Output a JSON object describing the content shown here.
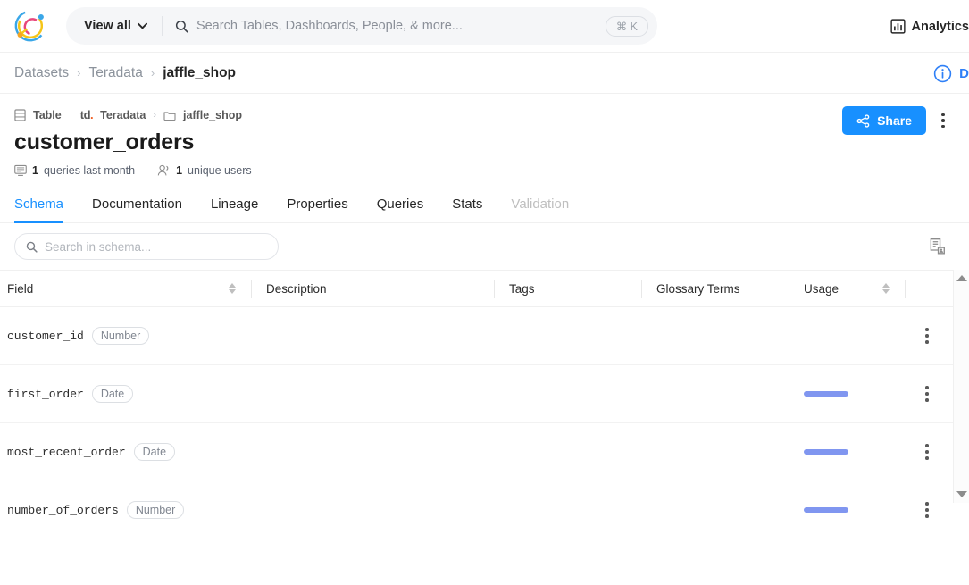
{
  "topbar": {
    "logo_name": "datahub-logo",
    "view_all_label": "View all",
    "search_placeholder": "Search Tables, Dashboards, People, & more...",
    "search_value": "",
    "shortcut_hint": "⌘ K",
    "nav_items": [
      {
        "label": "Analytics",
        "icon": "bar-chart-icon"
      }
    ]
  },
  "breadcrumb": {
    "items": [
      {
        "label": "Datasets",
        "current": false
      },
      {
        "label": "Teradata",
        "current": false
      },
      {
        "label": "jaffle_shop",
        "current": true
      }
    ],
    "separator": "›",
    "docs_label": "D"
  },
  "entity": {
    "type_label": "Table",
    "platform_logo": "td",
    "platform_logo_dot": ".",
    "platform_label": "Teradata",
    "container_label": "jaffle_shop",
    "container_separator": "›",
    "title": "customer_orders",
    "stats": [
      {
        "count": "1",
        "text": "queries last month",
        "icon": "query-monitor-icon"
      },
      {
        "count": "1",
        "text": "unique users",
        "icon": "users-icon"
      }
    ],
    "share_label": "Share",
    "share_color": "#1890ff",
    "menu_name": "more-options"
  },
  "tabs": [
    {
      "label": "Schema",
      "active": true,
      "disabled": false
    },
    {
      "label": "Documentation",
      "active": false,
      "disabled": false
    },
    {
      "label": "Lineage",
      "active": false,
      "disabled": false
    },
    {
      "label": "Properties",
      "active": false,
      "disabled": false
    },
    {
      "label": "Queries",
      "active": false,
      "disabled": false
    },
    {
      "label": "Stats",
      "active": false,
      "disabled": false
    },
    {
      "label": "Validation",
      "active": false,
      "disabled": true
    }
  ],
  "schema_toolbar": {
    "search_placeholder": "Search in schema...",
    "search_value": "",
    "raw_schema_icon": "raw-schema-icon"
  },
  "schema_table": {
    "columns": [
      {
        "label": "Field",
        "sortable": true
      },
      {
        "label": "Description",
        "sortable": false
      },
      {
        "label": "Tags",
        "sortable": false
      },
      {
        "label": "Glossary Terms",
        "sortable": false
      },
      {
        "label": "Usage",
        "sortable": true
      }
    ],
    "rows": [
      {
        "field": "customer_id",
        "type": "Number",
        "description": "",
        "tags": "",
        "glossary": "",
        "usage_width": 0
      },
      {
        "field": "first_order",
        "type": "Date",
        "description": "",
        "tags": "",
        "glossary": "",
        "usage_width": 50
      },
      {
        "field": "most_recent_order",
        "type": "Date",
        "description": "",
        "tags": "",
        "glossary": "",
        "usage_width": 50
      },
      {
        "field": "number_of_orders",
        "type": "Number",
        "description": "",
        "tags": "",
        "glossary": "",
        "usage_width": 50
      }
    ],
    "usage_bar_color": "#8096f0"
  }
}
